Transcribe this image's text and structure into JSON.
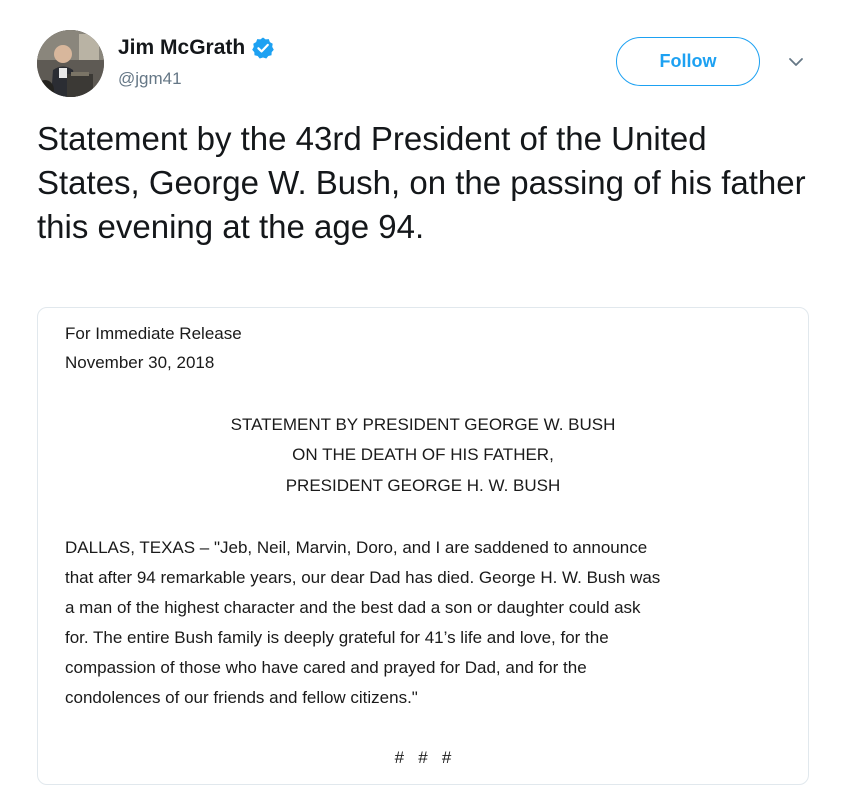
{
  "author": {
    "display_name": "Jim McGrath",
    "handle": "@jgm41",
    "verified": true,
    "verified_icon": "verified-badge-icon",
    "avatar": "avatar-photo"
  },
  "actions": {
    "follow_label": "Follow",
    "more_icon": "chevron-down-icon"
  },
  "colors": {
    "accent": "#1da1f2",
    "text": "#14171a",
    "secondary_text": "#657786",
    "border": "#e1e8ed"
  },
  "tweet": {
    "text": "Statement by the 43rd President of the United States, George W. Bush, on the passing of his father this evening at the age 94."
  },
  "media": {
    "release_label": "For Immediate Release",
    "release_date": "November 30, 2018",
    "heading": [
      "STATEMENT BY PRESIDENT GEORGE W. BUSH",
      "ON THE DEATH OF HIS FATHER,",
      "PRESIDENT GEORGE H. W. BUSH"
    ],
    "body_lines": [
      "DALLAS, TEXAS – \"Jeb, Neil, Marvin, Doro, and I are saddened to announce",
      "that after 94 remarkable years, our dear Dad has died. George H. W. Bush was",
      "a man of the highest character and the best dad a son or daughter could ask",
      "for. The entire Bush family is deeply grateful for 41’s life and love, for the",
      "compassion of those who have cared and prayed for Dad, and for the",
      "condolences of our friends and fellow citizens.\""
    ],
    "end_marks": "#   #   #"
  }
}
